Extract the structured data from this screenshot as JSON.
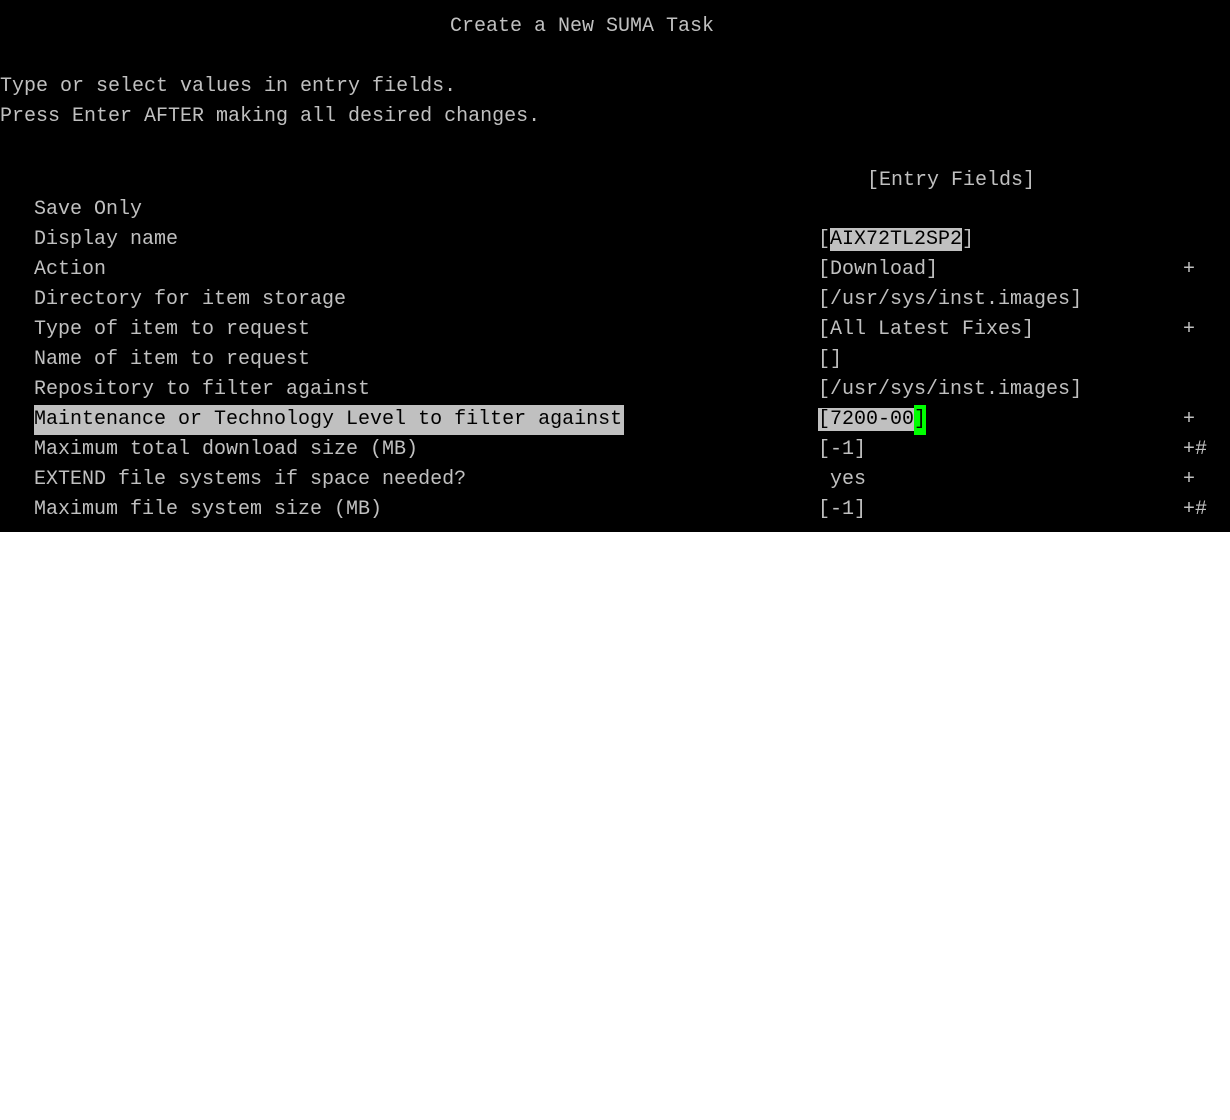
{
  "title": "Create a New SUMA Task",
  "instructions": [
    "Type or select values in entry fields.",
    "Press Enter AFTER making all desired changes."
  ],
  "entry_header": "[Entry Fields]",
  "fields": [
    {
      "label": "Save Only",
      "value": "",
      "flag": ""
    },
    {
      "label": "Display name",
      "value": "AIX72TL2SP2",
      "flag": ""
    },
    {
      "label": "Action",
      "value": "Download",
      "flag": "+"
    },
    {
      "label": "Directory for item storage",
      "value": "/usr/sys/inst.images",
      "flag": ""
    },
    {
      "label": "Type of item to request",
      "value": "All Latest Fixes",
      "flag": "+"
    },
    {
      "label": "Name of item to request",
      "value": "",
      "flag": ""
    },
    {
      "label": "Repository to filter against",
      "value": "/usr/sys/inst.images",
      "flag": ""
    },
    {
      "label": "Maintenance or Technology Level to filter against",
      "value": "7200-00",
      "flag": "+"
    },
    {
      "label": "Maximum total download size (MB)",
      "value": "-1",
      "flag": "+#"
    },
    {
      "label": "EXTEND file systems if space needed?",
      "value": "yes",
      "flag": "+"
    },
    {
      "label": "Maximum file system size (MB)",
      "value": "-1",
      "flag": "+#"
    }
  ],
  "colors": {
    "background": "#000000",
    "text": "#c0c0c0",
    "highlight": "#c0c0c0",
    "cursor": "#00ff00"
  }
}
